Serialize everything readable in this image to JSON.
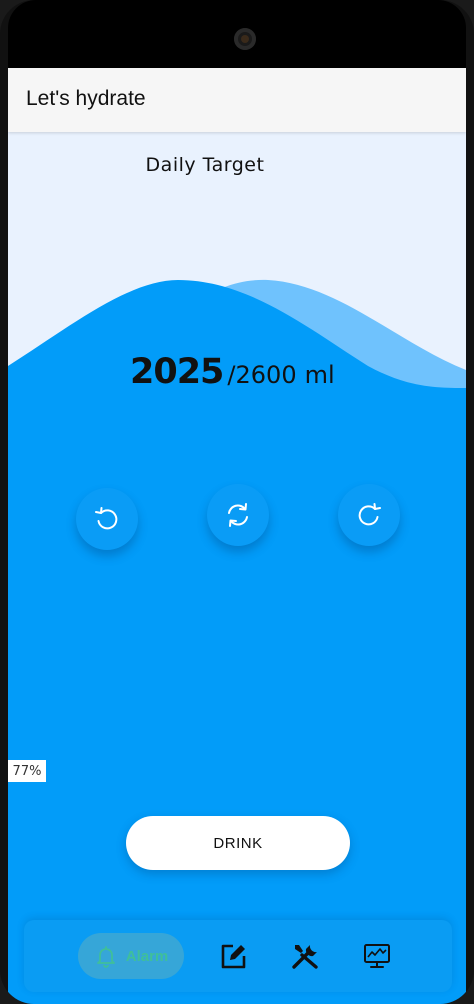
{
  "appbar": {
    "title": "Let's hydrate"
  },
  "main": {
    "daily_target_label": "Daily Target",
    "current_amount": "2025",
    "separator": "/",
    "target_amount": "2600",
    "unit": "ml",
    "progress_percent_label": "77%",
    "progress_fraction": 0.77,
    "drink_label": "DRINK",
    "actions": [
      {
        "icon": "undo-icon"
      },
      {
        "icon": "refresh-icon"
      },
      {
        "icon": "redo-icon"
      }
    ]
  },
  "bottom_nav": {
    "items": [
      {
        "label": "Alarm",
        "icon": "bell-icon",
        "selected": true
      },
      {
        "icon": "edit-icon"
      },
      {
        "icon": "tools-icon"
      },
      {
        "icon": "monitor-chart-icon"
      }
    ]
  },
  "colors": {
    "water": "#029cf9",
    "water_light": "#6fc2fd",
    "sky": "#e9f2fe",
    "appbar": "#f6f6f6",
    "alarm_text": "#3fbf9a"
  }
}
